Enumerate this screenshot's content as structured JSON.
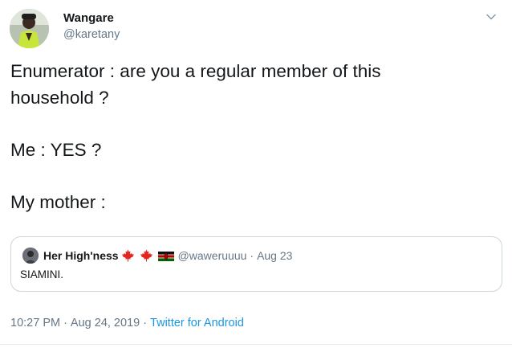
{
  "tweet": {
    "author": {
      "name": "Wangare",
      "handle": "@karetany",
      "avatar_icon": "profile-photo"
    },
    "menu_icon": "chevron-down-icon",
    "text_lines": [
      "Enumerator : are you a regular member of this",
      "household ?",
      "Me : YES ?",
      "My mother :"
    ],
    "quote": {
      "author_name": "Her High'ness",
      "flags": [
        "maple-leaf-icon",
        "maple-leaf-icon",
        "kenya-flag-icon"
      ],
      "handle": "@waweruuuu",
      "separator": "·",
      "date": "Aug 23",
      "text": "SIAMINI."
    },
    "meta": {
      "time": "10:27 PM",
      "separator": "·",
      "date": "Aug 24, 2019",
      "source": "Twitter for Android"
    }
  },
  "colors": {
    "text": "#14171a",
    "secondary": "#657786",
    "link": "#1b95e0",
    "border": "#ccd6dd",
    "maple_red": "#e0261f"
  }
}
